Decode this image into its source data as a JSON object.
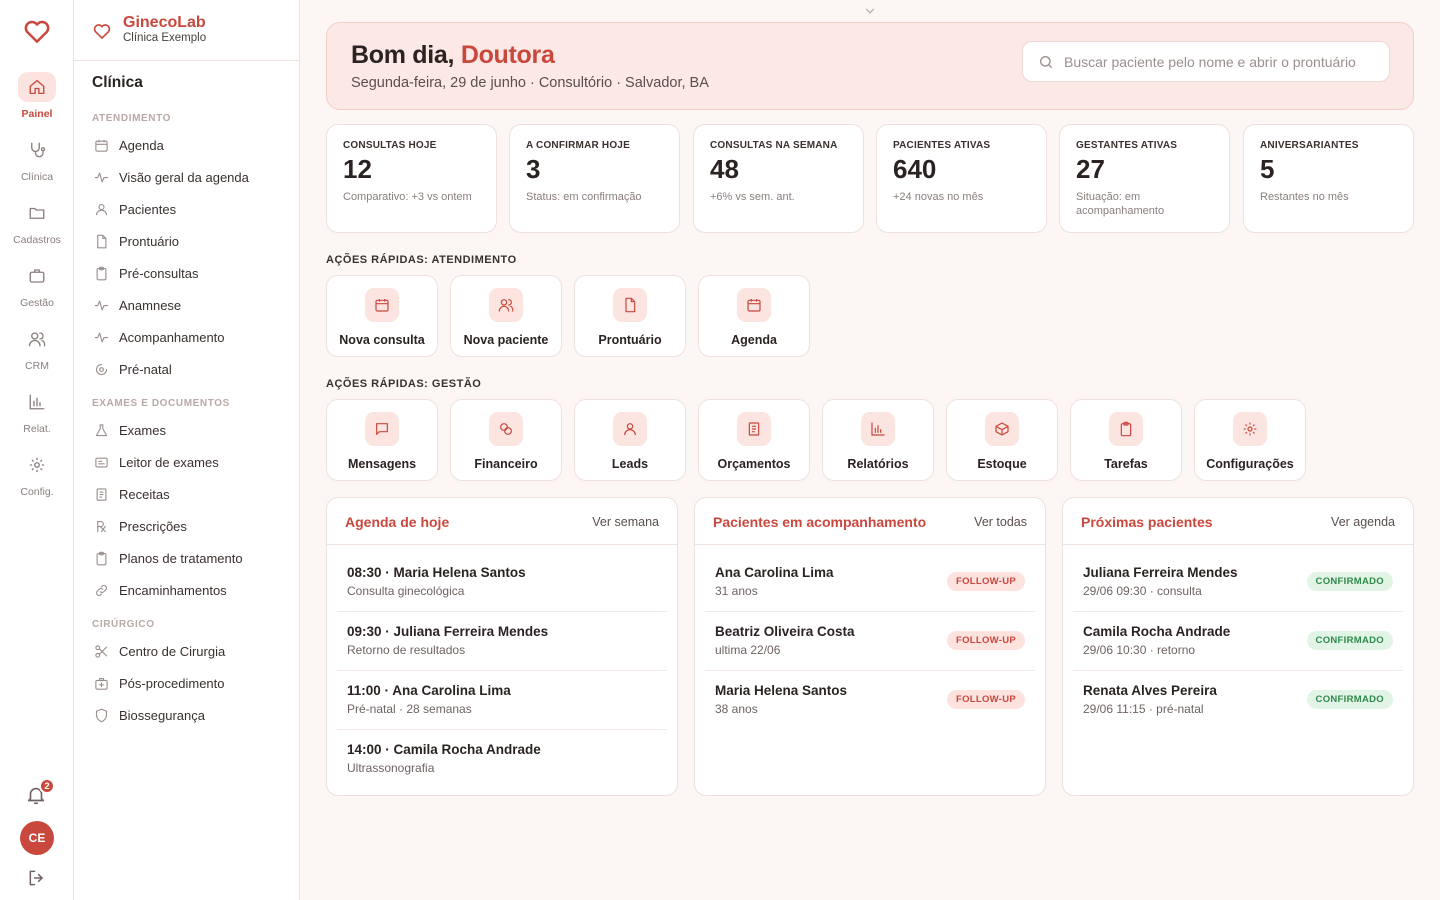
{
  "app": {
    "name": "GinecoLab",
    "clinic": "Clínica Exemplo"
  },
  "colors": {
    "accent": "#c9483e",
    "accent_soft": "#fce8e4",
    "success": "#2f8a4b",
    "background": "#fcf6f4"
  },
  "rail": {
    "items": [
      {
        "label": "Painel",
        "icon": "home-icon",
        "active": true
      },
      {
        "label": "Clínica",
        "icon": "stethoscope-icon",
        "active": false
      },
      {
        "label": "Cadastros",
        "icon": "folder-icon",
        "active": false
      },
      {
        "label": "Gestão",
        "icon": "briefcase-icon",
        "active": false
      },
      {
        "label": "CRM",
        "icon": "users-icon",
        "active": false
      },
      {
        "label": "Relat.",
        "icon": "bar-chart-icon",
        "active": false
      },
      {
        "label": "Config.",
        "icon": "gear-icon",
        "active": false
      }
    ],
    "notifications_count": "2",
    "avatar_initials": "CE"
  },
  "sidebar": {
    "title": "Clínica",
    "sections": [
      {
        "title": "ATENDIMENTO",
        "items": [
          {
            "label": "Agenda",
            "icon": "calendar-icon"
          },
          {
            "label": "Visão geral da agenda",
            "icon": "activity-icon"
          },
          {
            "label": "Pacientes",
            "icon": "user-icon"
          },
          {
            "label": "Prontuário",
            "icon": "file-icon"
          },
          {
            "label": "Pré-consultas",
            "icon": "clipboard-icon"
          },
          {
            "label": "Anamnese",
            "icon": "activity-icon"
          },
          {
            "label": "Acompanhamento",
            "icon": "activity-icon"
          },
          {
            "label": "Pré-natal",
            "icon": "baby-icon"
          }
        ]
      },
      {
        "title": "EXAMES E DOCUMENTOS",
        "items": [
          {
            "label": "Exames",
            "icon": "flask-icon"
          },
          {
            "label": "Leitor de exames",
            "icon": "card-icon"
          },
          {
            "label": "Receitas",
            "icon": "receipt-icon"
          },
          {
            "label": "Prescrições",
            "icon": "rx-icon"
          },
          {
            "label": "Planos de tratamento",
            "icon": "clipboard-icon"
          },
          {
            "label": "Encaminhamentos",
            "icon": "link-icon"
          }
        ]
      },
      {
        "title": "CIRÚRGICO",
        "items": [
          {
            "label": "Centro de Cirurgia",
            "icon": "scissors-icon"
          },
          {
            "label": "Pós-procedimento",
            "icon": "medkit-icon"
          },
          {
            "label": "Biossegurança",
            "icon": "shield-icon"
          }
        ]
      }
    ]
  },
  "hero": {
    "greeting": "Bom dia,",
    "name": "Doutora",
    "subtitle": "Segunda-feira, 29 de junho · Consultório · Salvador, BA",
    "search_placeholder": "Buscar paciente pelo nome e abrir o prontuário"
  },
  "stats": [
    {
      "label": "CONSULTAS HOJE",
      "value": "12",
      "note": "Comparativo: +3 vs ontem"
    },
    {
      "label": "A CONFIRMAR HOJE",
      "value": "3",
      "note": "Status: em confirmação"
    },
    {
      "label": "CONSULTAS NA SEMANA",
      "value": "48",
      "note": "+6% vs sem. ant."
    },
    {
      "label": "PACIENTES ATIVAS",
      "value": "640",
      "note": "+24 novas no mês"
    },
    {
      "label": "GESTANTES ATIVAS",
      "value": "27",
      "note": "Situação: em acompanhamento"
    },
    {
      "label": "ANIVERSARIANTES",
      "value": "5",
      "note": "Restantes no mês"
    }
  ],
  "quick_attendance": {
    "title": "AÇÕES RÁPIDAS: ATENDIMENTO",
    "items": [
      {
        "label": "Nova consulta",
        "icon": "calendar-icon"
      },
      {
        "label": "Nova paciente",
        "icon": "users-icon"
      },
      {
        "label": "Prontuário",
        "icon": "file-icon"
      },
      {
        "label": "Agenda",
        "icon": "calendar-icon"
      }
    ]
  },
  "quick_management": {
    "title": "AÇÕES RÁPIDAS: GESTÃO",
    "items": [
      {
        "label": "Mensagens",
        "icon": "message-icon"
      },
      {
        "label": "Financeiro",
        "icon": "coins-icon"
      },
      {
        "label": "Leads",
        "icon": "user-icon"
      },
      {
        "label": "Orçamentos",
        "icon": "receipt-icon"
      },
      {
        "label": "Relatórios",
        "icon": "bar-chart-icon"
      },
      {
        "label": "Estoque",
        "icon": "box-icon"
      },
      {
        "label": "Tarefas",
        "icon": "clipboard-icon"
      },
      {
        "label": "Configurações",
        "icon": "gear-icon"
      }
    ]
  },
  "panels": {
    "agenda": {
      "title": "Agenda de hoje",
      "link": "Ver semana",
      "rows": [
        {
          "main": "08:30 · Maria Helena Santos",
          "sub": "Consulta ginecológica"
        },
        {
          "main": "09:30 · Juliana Ferreira Mendes",
          "sub": "Retorno de resultados"
        },
        {
          "main": "11:00 · Ana Carolina Lima",
          "sub": "Pré-natal · 28 semanas"
        },
        {
          "main": "14:00 · Camila Rocha Andrade",
          "sub": "Ultrassonografia"
        }
      ]
    },
    "followup": {
      "title": "Pacientes em acompanhamento",
      "link": "Ver todas",
      "rows": [
        {
          "main": "Ana Carolina Lima",
          "sub": "31 anos",
          "badge": "FOLLOW-UP"
        },
        {
          "main": "Beatriz Oliveira Costa",
          "sub": "ultima 22/06",
          "badge": "FOLLOW-UP"
        },
        {
          "main": "Maria Helena Santos",
          "sub": "38 anos",
          "badge": "FOLLOW-UP"
        }
      ]
    },
    "next": {
      "title": "Próximas pacientes",
      "link": "Ver agenda",
      "rows": [
        {
          "main": "Juliana Ferreira Mendes",
          "sub": "29/06 09:30 · consulta",
          "badge": "CONFIRMADO"
        },
        {
          "main": "Camila Rocha Andrade",
          "sub": "29/06 10:30 · retorno",
          "badge": "CONFIRMADO"
        },
        {
          "main": "Renata Alves Pereira",
          "sub": "29/06 11:15 · pré-natal",
          "badge": "CONFIRMADO"
        }
      ]
    }
  }
}
